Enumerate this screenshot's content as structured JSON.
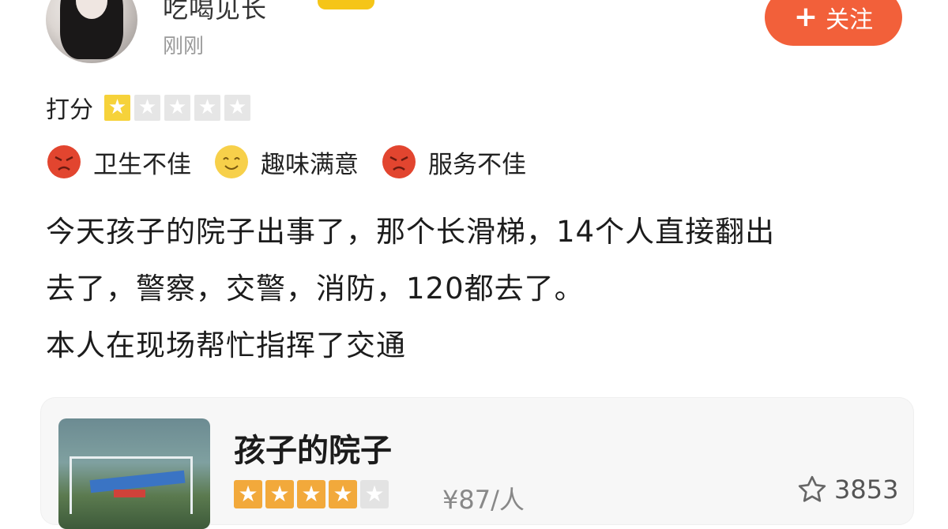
{
  "user": {
    "name": "吃喝见长",
    "time": "刚刚"
  },
  "follow_button": {
    "label": "关注",
    "icon": "plus-icon",
    "color": "#f2603a"
  },
  "rating": {
    "label": "打分",
    "stars_filled": 1,
    "stars_total": 5
  },
  "tags": [
    {
      "face": "angry-face-icon",
      "color": "#e2452f",
      "label": "卫生不佳"
    },
    {
      "face": "smile-face-icon",
      "color": "#f7d04a",
      "label": "趣味满意"
    },
    {
      "face": "angry-face-icon",
      "color": "#e2452f",
      "label": "服务不佳"
    }
  ],
  "review": {
    "lines": [
      "今天孩子的院子出事了，那个长滑梯，14个人直接翻出",
      "去了，警察，交警，消防，120都去了。",
      "本人在现场帮忙指挥了交通"
    ]
  },
  "place_card": {
    "title": "孩子的院子",
    "stars_filled": 4,
    "stars_total": 5,
    "price": "¥87/人",
    "favorites": "3853",
    "star_color": "#f2a93b"
  }
}
